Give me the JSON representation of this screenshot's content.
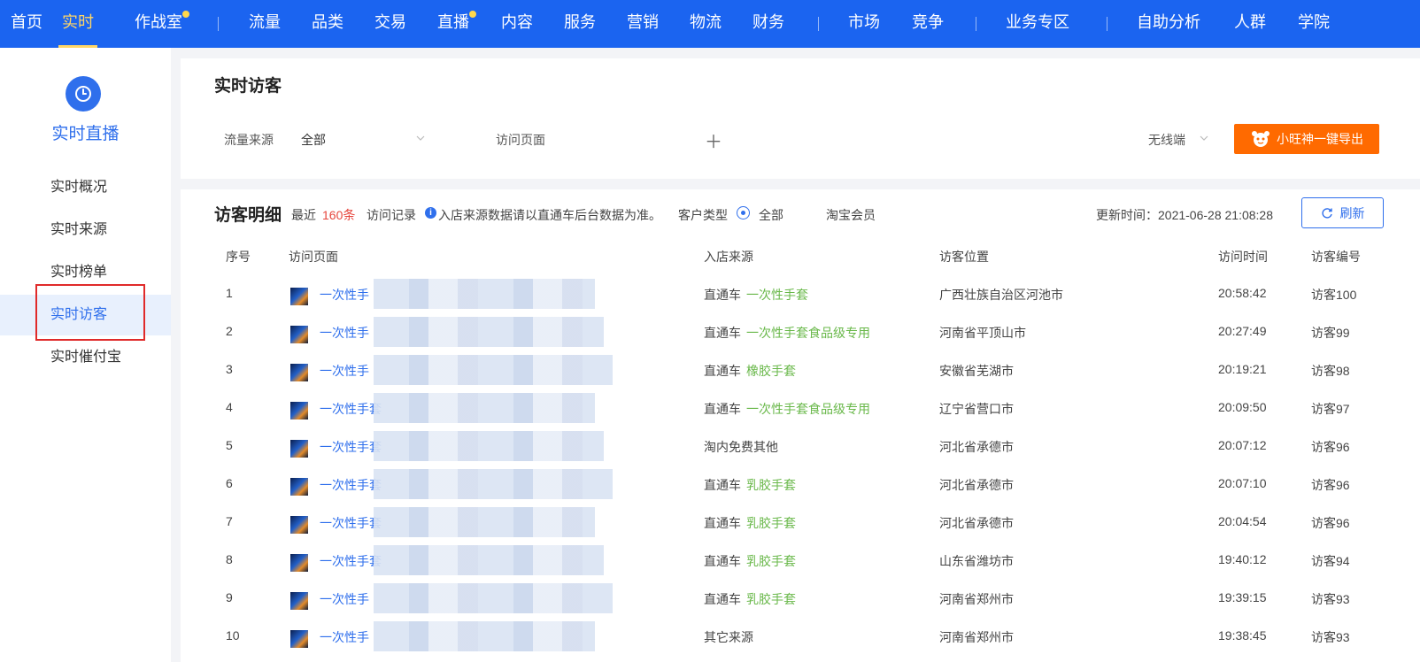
{
  "nav": {
    "items": [
      {
        "label": "首页",
        "dot": false
      },
      {
        "label": "实时",
        "dot": false,
        "active": true
      },
      {
        "label": "作战室",
        "dot": true
      },
      {
        "label": "流量",
        "dot": false
      },
      {
        "label": "品类",
        "dot": false
      },
      {
        "label": "交易",
        "dot": false
      },
      {
        "label": "直播",
        "dot": true
      },
      {
        "label": "内容",
        "dot": false
      },
      {
        "label": "服务",
        "dot": false
      },
      {
        "label": "营销",
        "dot": false
      },
      {
        "label": "物流",
        "dot": false
      },
      {
        "label": "财务",
        "dot": false
      },
      {
        "label": "市场",
        "dot": false
      },
      {
        "label": "竞争",
        "dot": false
      },
      {
        "label": "业务专区",
        "dot": false
      },
      {
        "label": "自助分析",
        "dot": false
      },
      {
        "label": "人群",
        "dot": false
      },
      {
        "label": "学院",
        "dot": false
      }
    ]
  },
  "sidebar": {
    "title": "实时直播",
    "items": [
      {
        "label": "实时概况"
      },
      {
        "label": "实时来源"
      },
      {
        "label": "实时榜单"
      },
      {
        "label": "实时访客",
        "active": true
      },
      {
        "label": "实时催付宝"
      }
    ]
  },
  "filter": {
    "title": "实时访客",
    "source_label": "流量来源",
    "source_value": "全部",
    "page_label": "访问页面",
    "device": "无线端",
    "export_label": "小旺神一键导出"
  },
  "table": {
    "title": "访客明细",
    "recent": "最近",
    "count": "160条",
    "records": "访问记录",
    "notice": "入店来源数据请以直通车后台数据为准。",
    "customer_type": "客户类型",
    "type_all": "全部",
    "type_member": "淘宝会员",
    "update_time": "更新时间：2021-06-28 21:08:28",
    "refresh_label": "刷新",
    "columns": [
      "序号",
      "访问页面",
      "入店来源",
      "访客位置",
      "访问时间",
      "访客编号"
    ],
    "rows": [
      {
        "no": "1",
        "page": "一次性手",
        "src": "直通车",
        "kw": "一次性手套",
        "loc": "广西壮族自治区河池市",
        "time": "20:58:42",
        "visitor": "访客100"
      },
      {
        "no": "2",
        "page": "一次性手",
        "src": "直通车",
        "kw": "一次性手套食品级专用",
        "loc": "河南省平顶山市",
        "time": "20:27:49",
        "visitor": "访客99"
      },
      {
        "no": "3",
        "page": "一次性手",
        "src": "直通车",
        "kw": "橡胶手套",
        "loc": "安徽省芜湖市",
        "time": "20:19:21",
        "visitor": "访客98"
      },
      {
        "no": "4",
        "page": "一次性手套",
        "src": "直通车",
        "kw": "一次性手套食品级专用",
        "loc": "辽宁省营口市",
        "time": "20:09:50",
        "visitor": "访客97"
      },
      {
        "no": "5",
        "page": "一次性手套",
        "src": "淘内免费其他",
        "kw": "",
        "loc": "河北省承德市",
        "time": "20:07:12",
        "visitor": "访客96"
      },
      {
        "no": "6",
        "page": "一次性手套",
        "src": "直通车",
        "kw": "乳胶手套",
        "loc": "河北省承德市",
        "time": "20:07:10",
        "visitor": "访客96"
      },
      {
        "no": "7",
        "page": "一次性手套",
        "src": "直通车",
        "kw": "乳胶手套",
        "loc": "河北省承德市",
        "time": "20:04:54",
        "visitor": "访客96"
      },
      {
        "no": "8",
        "page": "一次性手套",
        "src": "直通车",
        "kw": "乳胶手套",
        "loc": "山东省潍坊市",
        "time": "19:40:12",
        "visitor": "访客94"
      },
      {
        "no": "9",
        "page": "一次性手",
        "src": "直通车",
        "kw": "乳胶手套",
        "loc": "河南省郑州市",
        "time": "19:39:15",
        "visitor": "访客93"
      },
      {
        "no": "10",
        "page": "一次性手",
        "src": "其它来源",
        "kw": "",
        "loc": "河南省郑州市",
        "time": "19:38:45",
        "visitor": "访客93"
      }
    ]
  },
  "colors": {
    "nav_bg": "#1b64f0",
    "accent": "#2f6fec",
    "orange": "#ff6a00",
    "keyword_green": "#69b84a",
    "count_red": "#e6453c"
  }
}
